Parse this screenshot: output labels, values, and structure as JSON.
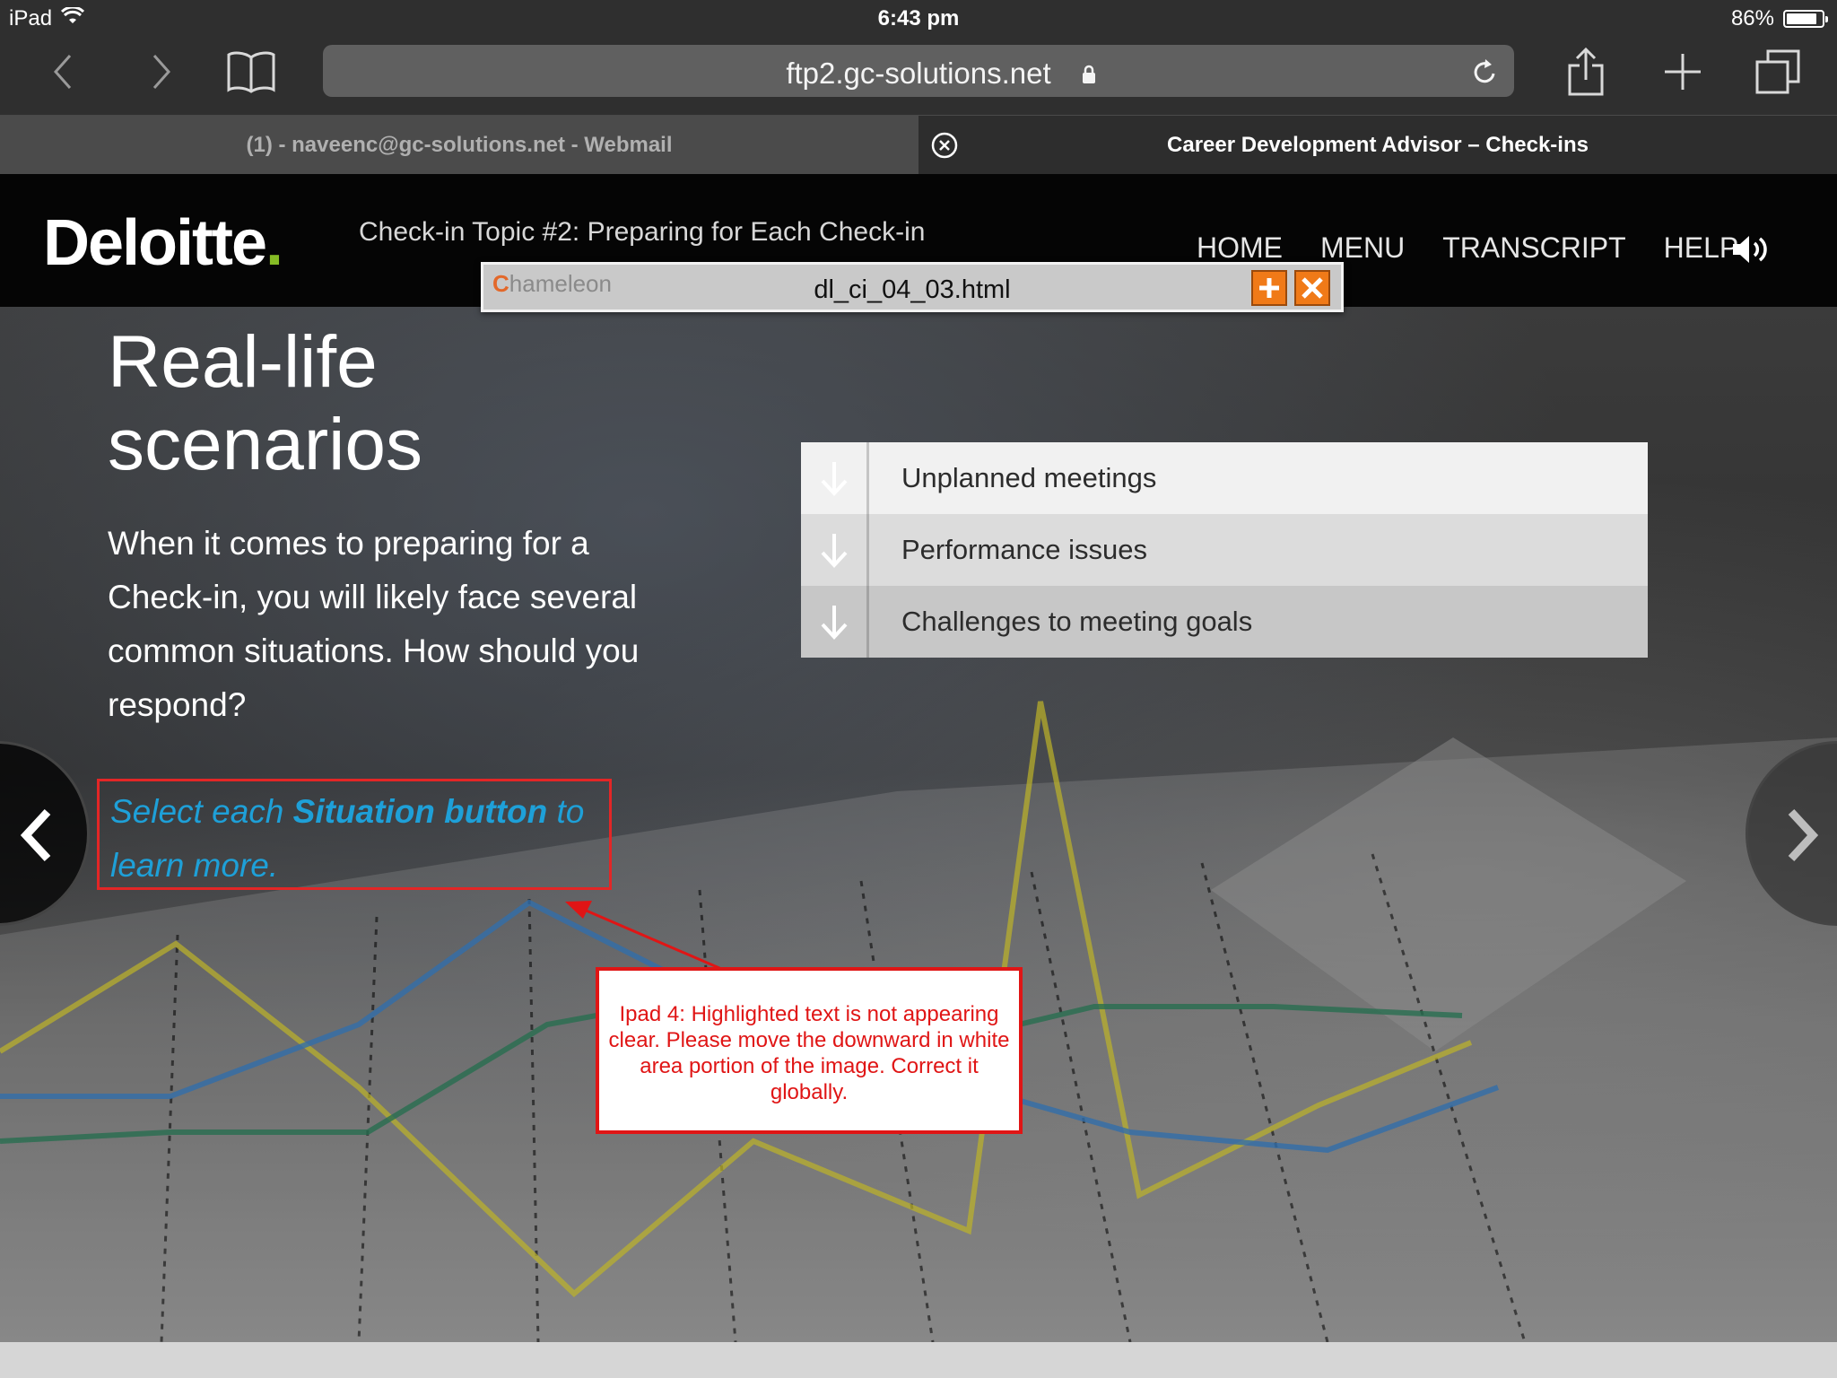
{
  "status_bar": {
    "device": "iPad",
    "time": "6:43 pm",
    "battery": "86%",
    "battery_level": 0.86
  },
  "browser": {
    "url": "ftp2.gc-solutions.net",
    "tabs": [
      {
        "label": "(1) - naveenc@gc-solutions.net - Webmail",
        "active": false
      },
      {
        "label": "Career Development Advisor – Check-ins",
        "active": true
      }
    ]
  },
  "course": {
    "logo": "Deloitte",
    "logo_dot": ".",
    "topic": "Check-in Topic #2: Preparing for Each Check-in",
    "nav": [
      "HOME",
      "MENU",
      "TRANSCRIPT",
      "HELP"
    ],
    "brand_accent": "#86bc25"
  },
  "chameleon": {
    "brand": "hameleon",
    "brand_initial": "C",
    "filename": "dl_ci_04_03.html"
  },
  "slide": {
    "title_line1": "Real-life",
    "title_line2": "scenarios",
    "body": "When it comes to preparing for a Check-in, you will likely face several common situations. How should you respond?",
    "instruction_pre": "Select each ",
    "instruction_em": "Situation button",
    "instruction_post": " to learn more.",
    "instruction_color": "#1ea0d8",
    "situations": [
      "Unplanned meetings",
      "Performance issues",
      "Challenges to meeting goals"
    ]
  },
  "annotation": {
    "text": "Ipad 4: Highlighted text is not appearing clear. Please move the downward in white area portion of the image. Correct it globally.",
    "color": "#e01515"
  }
}
